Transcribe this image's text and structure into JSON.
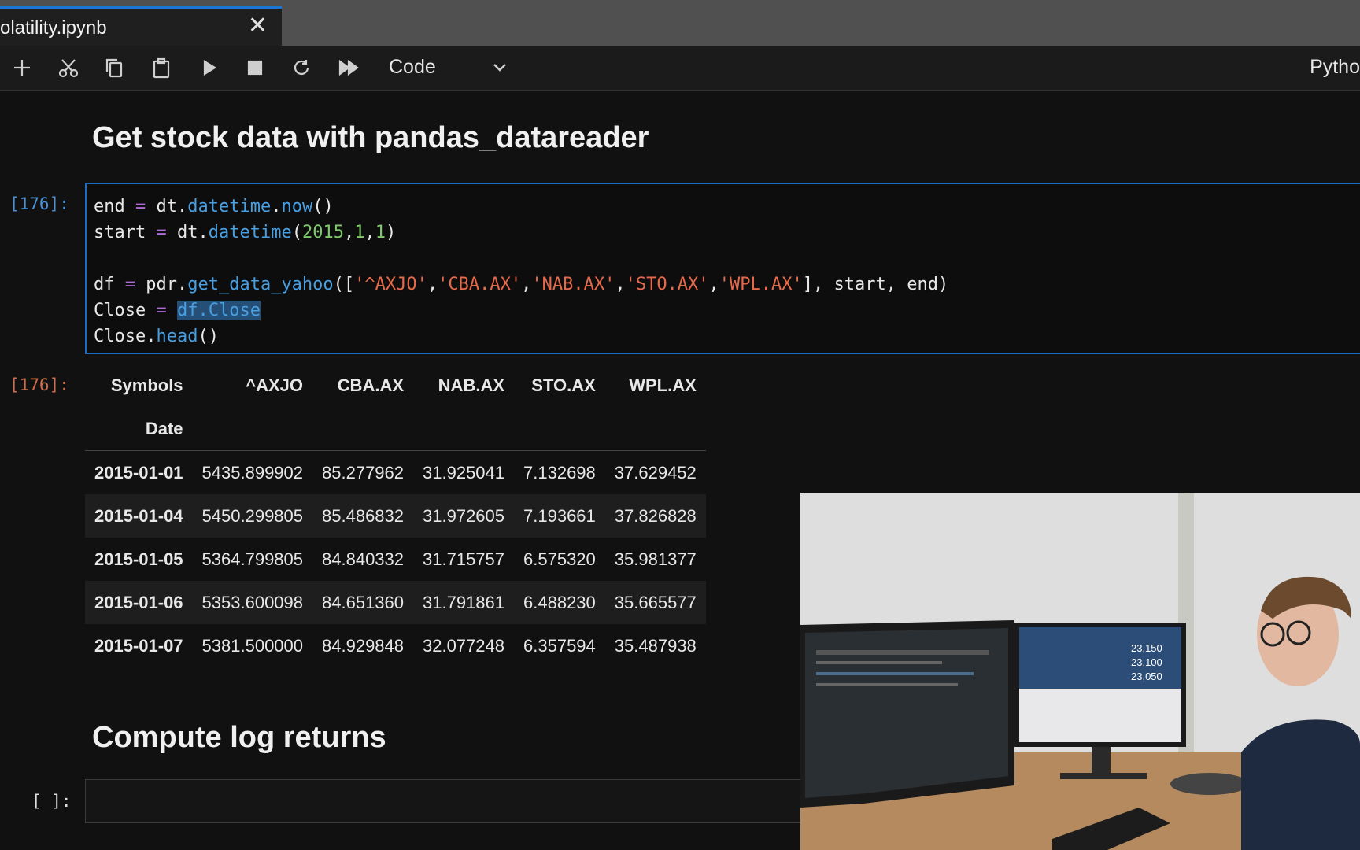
{
  "tab": {
    "title": "olatility.ipynb",
    "close_symbol": "✕"
  },
  "toolbar": {
    "buttons": [
      "add-cell",
      "cut",
      "copy",
      "paste",
      "run",
      "stop",
      "restart",
      "run-all"
    ],
    "cell_type": "Code",
    "kernel": "Pytho"
  },
  "cells": {
    "heading1": "Get stock data with pandas_datareader",
    "code_prompt": "[176]:",
    "output_prompt": "[176]:",
    "heading2": "Compute log returns",
    "empty_prompt": "[ ]:"
  },
  "code": {
    "line1": [
      "end",
      " = ",
      "dt.",
      "datetime",
      ".",
      "now",
      "()"
    ],
    "line2": [
      "start",
      " = ",
      "dt.",
      "datetime",
      "(",
      "2015",
      ",",
      "1",
      ",",
      "1",
      ")"
    ],
    "line4": [
      "df",
      " = ",
      "pdr.",
      "get_data_yahoo",
      "([",
      "'^AXJO'",
      ",",
      "'CBA.AX'",
      ",",
      "'NAB.AX'",
      ",",
      "'STO.AX'",
      ",",
      "'WPL.AX'",
      "], start, end)"
    ],
    "line5": [
      "Close",
      " = ",
      "df.Close"
    ],
    "line6": [
      "Close.",
      "head",
      "()"
    ]
  },
  "table": {
    "columns_label": "Symbols",
    "index_label": "Date",
    "columns": [
      "^AXJO",
      "CBA.AX",
      "NAB.AX",
      "STO.AX",
      "WPL.AX"
    ],
    "rows": [
      [
        "2015-01-01",
        "5435.899902",
        "85.277962",
        "31.925041",
        "7.132698",
        "37.629452"
      ],
      [
        "2015-01-04",
        "5450.299805",
        "85.486832",
        "31.972605",
        "7.193661",
        "37.826828"
      ],
      [
        "2015-01-05",
        "5364.799805",
        "84.840332",
        "31.715757",
        "6.575320",
        "35.981377"
      ],
      [
        "2015-01-06",
        "5353.600098",
        "84.651360",
        "31.791861",
        "6.488230",
        "35.665577"
      ],
      [
        "2015-01-07",
        "5381.500000",
        "84.929848",
        "32.077248",
        "6.357594",
        "35.487938"
      ]
    ]
  },
  "webcam": {
    "monitor_prices": [
      "23,150",
      "23,100",
      "23,050"
    ]
  }
}
